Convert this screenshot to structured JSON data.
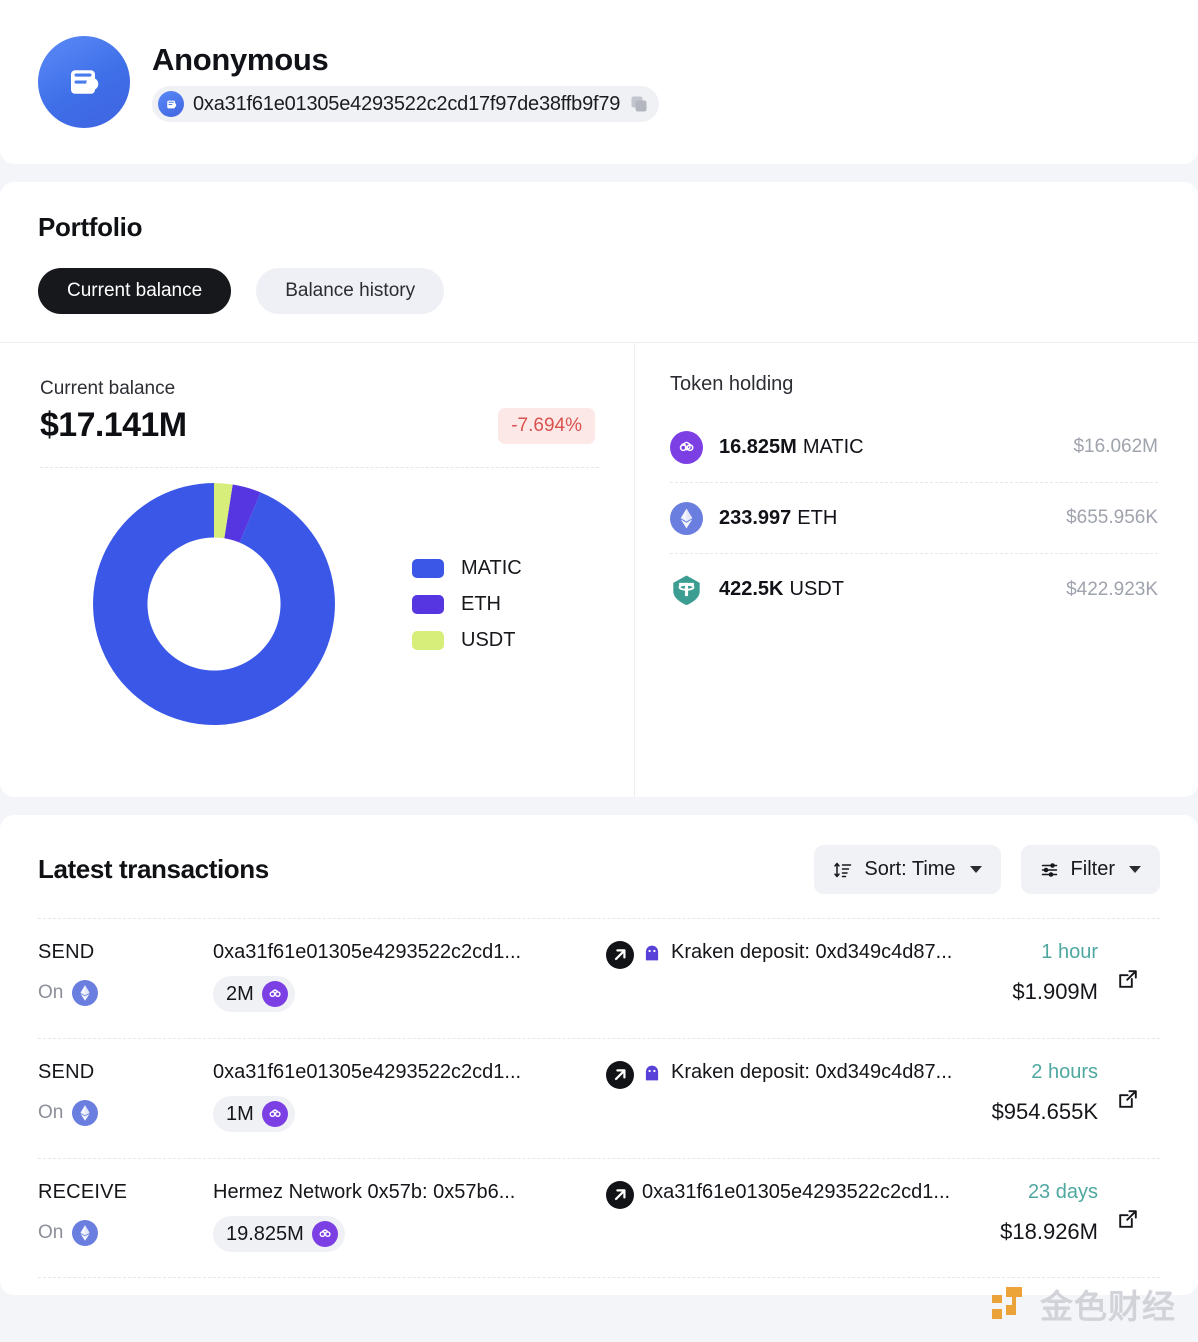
{
  "header": {
    "user_name": "Anonymous",
    "address": "0xa31f61e01305e4293522c2cd17f97de38ffb9f79",
    "avatar_icon": "wallet-icon",
    "copy_icon": "copy-icon"
  },
  "portfolio": {
    "title": "Portfolio",
    "tabs": [
      {
        "label": "Current balance",
        "active": true
      },
      {
        "label": "Balance history",
        "active": false
      }
    ],
    "balance": {
      "label": "Current balance",
      "amount": "$17.141M",
      "delta": "-7.694%",
      "delta_color": "#d8524f",
      "delta_bg": "#fde8e8"
    },
    "token_holding": {
      "title": "Token holding",
      "rows": [
        {
          "amount": "16.825M",
          "symbol": "MATIC",
          "usd": "$16.062M",
          "icon": "polygon-icon"
        },
        {
          "amount": "233.997",
          "symbol": "ETH",
          "usd": "$655.956K",
          "icon": "ethereum-icon"
        },
        {
          "amount": "422.5K",
          "symbol": "USDT",
          "usd": "$422.923K",
          "icon": "tether-icon"
        }
      ]
    }
  },
  "chart_data": {
    "type": "pie",
    "title": "Current balance allocation",
    "labels": [
      "MATIC",
      "ETH",
      "USDT"
    ],
    "values": [
      16.062,
      0.655956,
      0.422923
    ],
    "value_unit": "USD millions",
    "percentages": [
      93.71,
      3.83,
      2.47
    ],
    "colors": [
      "#3a57e8",
      "#5636e0",
      "#d8ee7a"
    ],
    "legend_position": "right",
    "donut": true,
    "inner_radius_ratio": 0.55,
    "start_angle_deg": 90,
    "direction": "counterclockwise"
  },
  "transactions": {
    "title": "Latest transactions",
    "sort": {
      "label": "Sort: Time",
      "icon": "sort-icon"
    },
    "filter": {
      "label": "Filter",
      "icon": "filter-icon"
    },
    "rows": [
      {
        "type": "SEND",
        "on_label": "On",
        "chain_icon": "ethereum-icon",
        "from": "0xa31f61e01305e4293522c2cd1...",
        "amount": "2M",
        "amount_token_icon": "polygon-icon",
        "to": "Kraken deposit: 0xd349c4d87...",
        "to_icon": "kraken-icon",
        "time": "1 hour",
        "value": "$1.909M"
      },
      {
        "type": "SEND",
        "on_label": "On",
        "chain_icon": "ethereum-icon",
        "from": "0xa31f61e01305e4293522c2cd1...",
        "amount": "1M",
        "amount_token_icon": "polygon-icon",
        "to": "Kraken deposit: 0xd349c4d87...",
        "to_icon": "kraken-icon",
        "time": "2 hours",
        "value": "$954.655K"
      },
      {
        "type": "RECEIVE",
        "on_label": "On",
        "chain_icon": "ethereum-icon",
        "from": "Hermez Network 0x57b: 0x57b6...",
        "amount": "19.825M",
        "amount_token_icon": "polygon-icon",
        "to": "0xa31f61e01305e4293522c2cd1...",
        "to_icon": "",
        "time": "23 days",
        "value": "$18.926M"
      }
    ]
  },
  "watermark": {
    "text": "金色财经",
    "mark_color": "#eb9c28"
  }
}
